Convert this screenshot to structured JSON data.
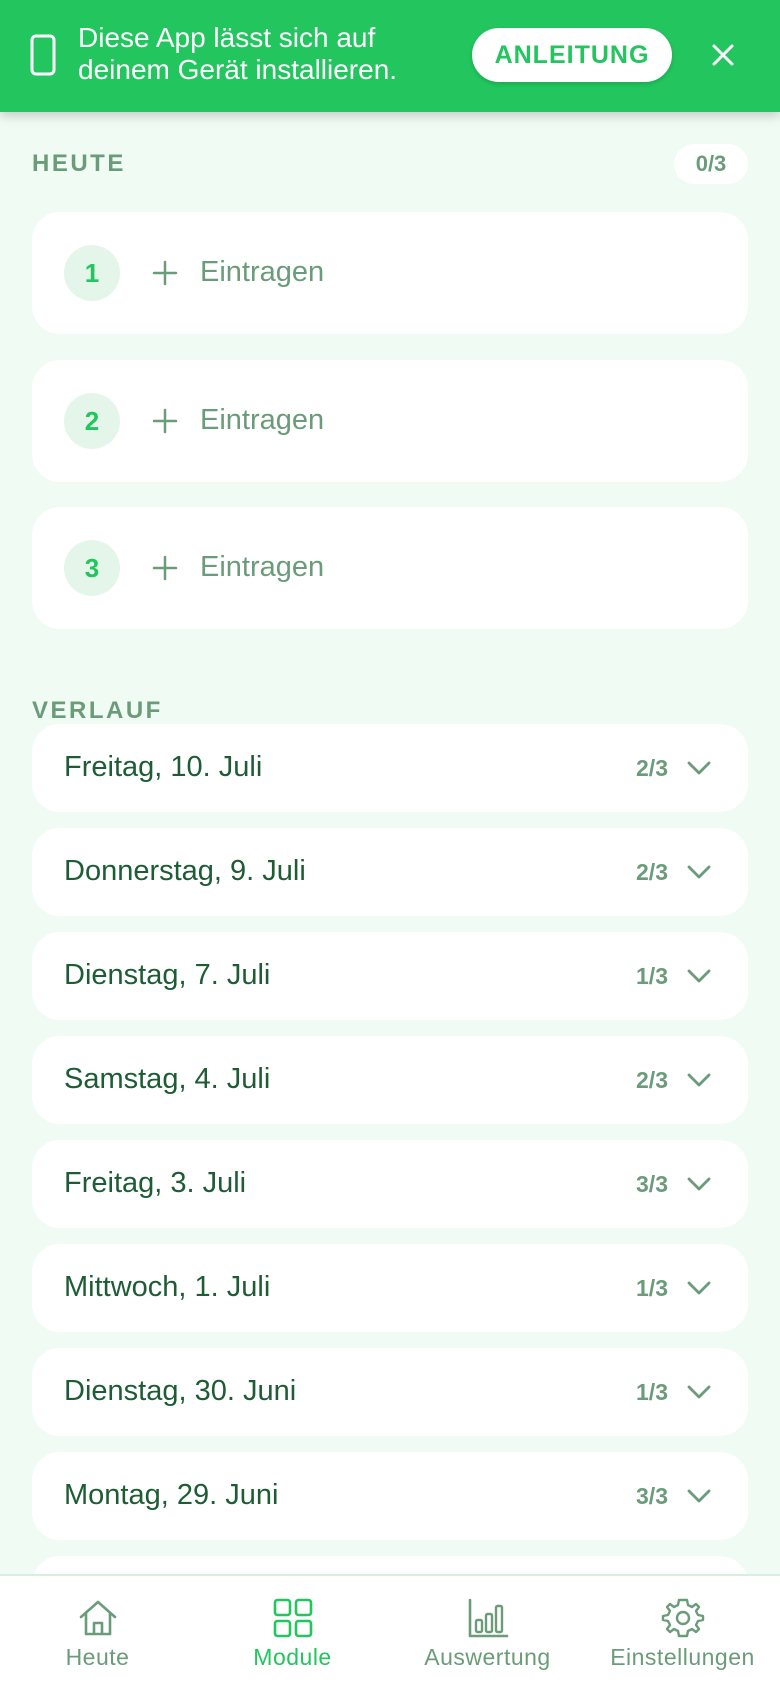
{
  "banner": {
    "message": "Diese App lässt sich auf deinem Gerät installieren.",
    "guide_label": "ANLEITUNG"
  },
  "today": {
    "title": "HEUTE",
    "count": "0/3",
    "slots": [
      {
        "number": "1",
        "action_label": "Eintragen"
      },
      {
        "number": "2",
        "action_label": "Eintragen"
      },
      {
        "number": "3",
        "action_label": "Eintragen"
      }
    ]
  },
  "history": {
    "title": "VERLAUF",
    "days": [
      {
        "date": "Freitag, 10. Juli",
        "score": "2/3"
      },
      {
        "date": "Donnerstag, 9. Juli",
        "score": "2/3"
      },
      {
        "date": "Dienstag, 7. Juli",
        "score": "1/3"
      },
      {
        "date": "Samstag, 4. Juli",
        "score": "2/3"
      },
      {
        "date": "Freitag, 3. Juli",
        "score": "3/3"
      },
      {
        "date": "Mittwoch, 1. Juli",
        "score": "1/3"
      },
      {
        "date": "Dienstag, 30. Juni",
        "score": "1/3"
      },
      {
        "date": "Montag, 29. Juni",
        "score": "3/3"
      }
    ]
  },
  "nav": {
    "items": [
      {
        "label": "Heute",
        "icon": "home-icon"
      },
      {
        "label": "Module",
        "icon": "grid-icon",
        "active": true
      },
      {
        "label": "Auswertung",
        "icon": "bar-chart-icon"
      },
      {
        "label": "Einstellungen",
        "icon": "gear-icon"
      }
    ]
  },
  "colors": {
    "accent": "#22c55e",
    "background": "#effbf3",
    "muted_text": "#6b9c7a",
    "primary_text": "#1d5c34"
  }
}
